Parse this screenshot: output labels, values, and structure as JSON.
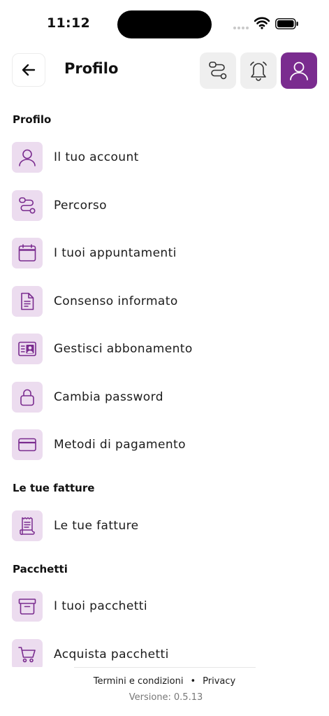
{
  "status_bar": {
    "time": "11:12"
  },
  "header": {
    "title": "Profilo"
  },
  "sections": {
    "profilo": {
      "title": "Profilo",
      "items": [
        {
          "label": "Il tuo account",
          "icon": "user-icon"
        },
        {
          "label": "Percorso",
          "icon": "route-icon"
        },
        {
          "label": "I tuoi appuntamenti",
          "icon": "calendar-icon"
        },
        {
          "label": "Consenso informato",
          "icon": "document-icon"
        },
        {
          "label": "Gestisci abbonamento",
          "icon": "id-card-icon"
        },
        {
          "label": "Cambia password",
          "icon": "lock-icon"
        },
        {
          "label": "Metodi di pagamento",
          "icon": "credit-card-icon"
        }
      ]
    },
    "fatture": {
      "title": "Le tue fatture",
      "items": [
        {
          "label": "Le tue fatture",
          "icon": "receipt-icon"
        }
      ]
    },
    "pacchetti": {
      "title": "Pacchetti",
      "items": [
        {
          "label": "I tuoi pacchetti",
          "icon": "archive-box-icon"
        },
        {
          "label": "Acquista pacchetti",
          "icon": "cart-icon"
        }
      ]
    }
  },
  "footer": {
    "terms": "Termini e condizioni",
    "separator": "•",
    "privacy": "Privacy",
    "version_label": "Versione:",
    "version": "0.5.13"
  },
  "colors": {
    "accent": "#7a2c8f",
    "icon_bg": "#ecdcef",
    "header_btn_bg": "#efefef"
  }
}
